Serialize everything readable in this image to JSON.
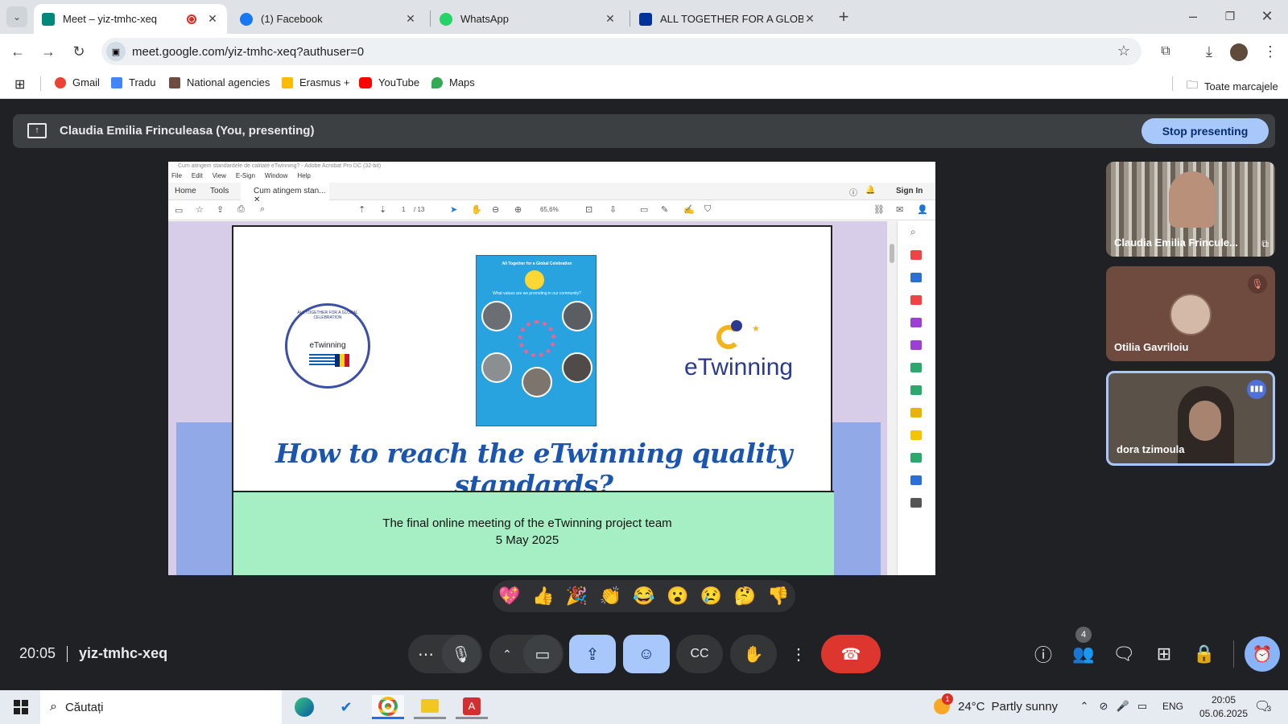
{
  "browser": {
    "tabs": [
      {
        "title": "Meet – yiz-tmhc-xeq",
        "favicon_color": "#00897b",
        "active": true
      },
      {
        "title": "(1) Facebook",
        "favicon_color": "#1877f2",
        "active": false
      },
      {
        "title": "WhatsApp",
        "favicon_color": "#25d366",
        "active": false
      },
      {
        "title": "ALL TOGETHER FOR A GLOBAL",
        "favicon_color": "#003399",
        "active": false
      }
    ],
    "url": "meet.google.com/yiz-tmhc-xeq?authuser=0",
    "bookmarks": [
      {
        "label": "Gmail",
        "color": "#ea4335"
      },
      {
        "label": "Tradu",
        "color": "#4285f4"
      },
      {
        "label": "National agencies",
        "color": "#6d4c41"
      },
      {
        "label": "Erasmus +",
        "color": "#fbbc05"
      },
      {
        "label": "YouTube",
        "color": "#ff0000"
      },
      {
        "label": "Maps",
        "color": "#34a853"
      }
    ],
    "all_bookmarks": "Toate marcajele"
  },
  "meet": {
    "presenting_banner": "Claudia Emilia Frinculeasa (You, presenting)",
    "stop_presenting": "Stop presenting",
    "time": "20:05",
    "meeting_code": "yiz-tmhc-xeq",
    "participant_count": "4",
    "reactions": [
      "💖",
      "👍",
      "🎉",
      "👏",
      "😂",
      "😮",
      "😢",
      "🤔",
      "👎"
    ],
    "participants": [
      {
        "name": "Claudia Emilia Frincule...",
        "bg": "#8d8b84"
      },
      {
        "name": "Otilia Gavriloiu",
        "bg": "#6e4a3f"
      },
      {
        "name": "dora tzimoula",
        "bg": "#5a5148"
      }
    ]
  },
  "shared_screen": {
    "window_title": "Cum atingem standardele de calitate eTwinning? - Adobe Acrobat Pro DC (32-bit)",
    "menu": [
      "File",
      "Edit",
      "View",
      "E-Sign",
      "Window",
      "Help"
    ],
    "nav": [
      "Home",
      "Tools"
    ],
    "doc_tab": "Cum atingem stan...",
    "sign_in": "Sign In",
    "page": "1",
    "page_total": "/ 13",
    "zoom": "65,6%",
    "slide": {
      "title": "How to reach the eTwinning quality standards?",
      "line1": "The final online meeting of the eTwinning project team",
      "line2": "5 May 2025",
      "logo_text": "eTwinning",
      "badge_ring": "ALL TOGETHER FOR A GLOBAL CELEBRATION",
      "badge_inner": "eTwinning",
      "poster_title": "All Together for a Global Celebration",
      "poster_question": "What values are we promoting in our community?"
    }
  },
  "taskbar": {
    "search_placeholder": "Căutați",
    "weather_temp": "24°C",
    "weather_text": "Partly sunny",
    "weather_badge": "1",
    "lang": "ENG",
    "time": "20:05",
    "date": "05.06.2025",
    "notif_count": "3"
  }
}
